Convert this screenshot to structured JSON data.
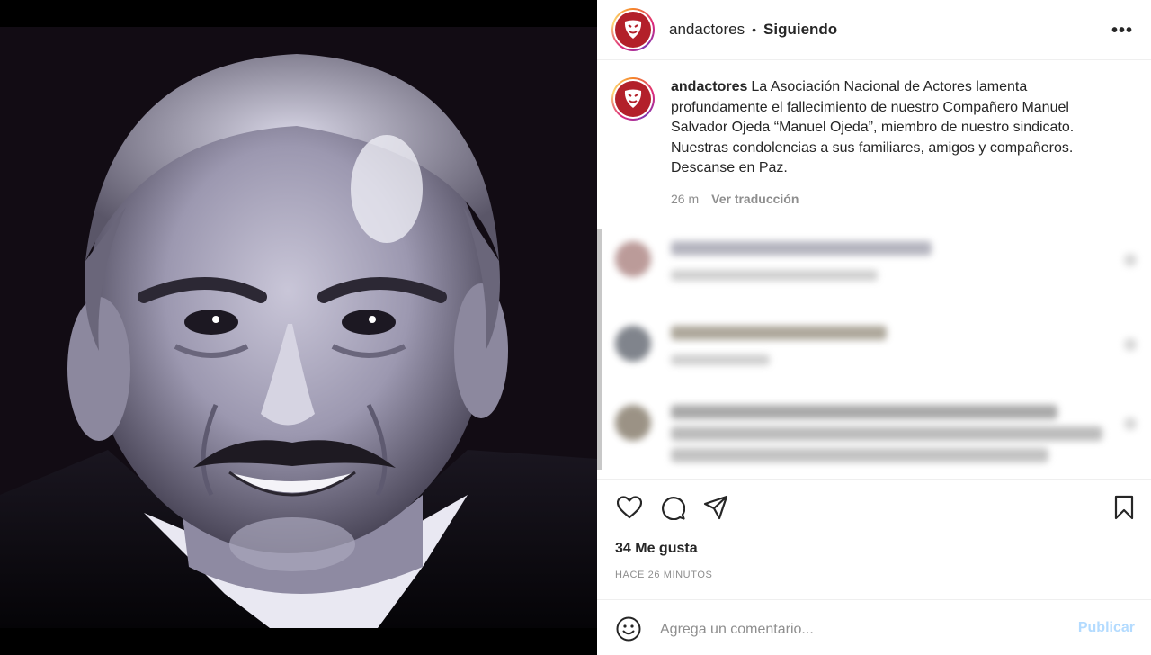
{
  "post": {
    "username": "andactores",
    "follow_status": "Siguiendo",
    "more_icon": "more-options-icon",
    "caption_text": "La Asociación Nacional de Actores lamenta profundamente el fallecimiento de nuestro Compañero Manuel Salvador Ojeda “Manuel Ojeda”, miembro de nuestro sindicato. Nuestras condolencias a sus familiares, amigos y compañeros. Descanse en Paz.",
    "caption_age": "26 m",
    "translate_label": "Ver traducción",
    "likes": "34 Me gusta",
    "posted_ago": "HACE 26 MINUTOS"
  },
  "comment_box": {
    "placeholder": "Agrega un comentario...",
    "publish_label": "Publicar"
  },
  "icons": {
    "like": "heart-icon",
    "comment": "comment-icon",
    "share": "share-icon",
    "save": "bookmark-icon",
    "emoji": "emoji-icon"
  },
  "colors": {
    "brand_red": "#b3202a",
    "publish_disabled": "#b3dbff",
    "muted_text": "#8e8e8e",
    "text": "#262626"
  }
}
